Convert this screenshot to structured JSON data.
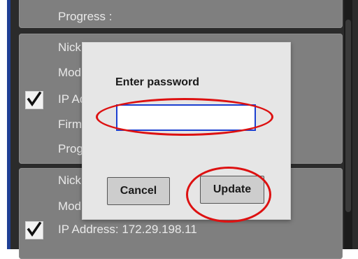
{
  "devices": [
    {
      "rows": [
        "Progress :"
      ]
    },
    {
      "checked": true,
      "rows": [
        "Nick",
        "Mod",
        "IP Ad",
        "Firm",
        "Prog"
      ]
    },
    {
      "checked": true,
      "rows": [
        "Nick",
        "Mod",
        "IP Address: 172.29.198.11"
      ]
    }
  ],
  "dialog": {
    "title": "Enter password",
    "password_value": "",
    "cancel_label": "Cancel",
    "update_label": "Update"
  },
  "colors": {
    "annotation": "#dd1111",
    "input_border": "#1c3fd0",
    "card": "#7f7f7f",
    "panel": "#2b2b2b"
  }
}
